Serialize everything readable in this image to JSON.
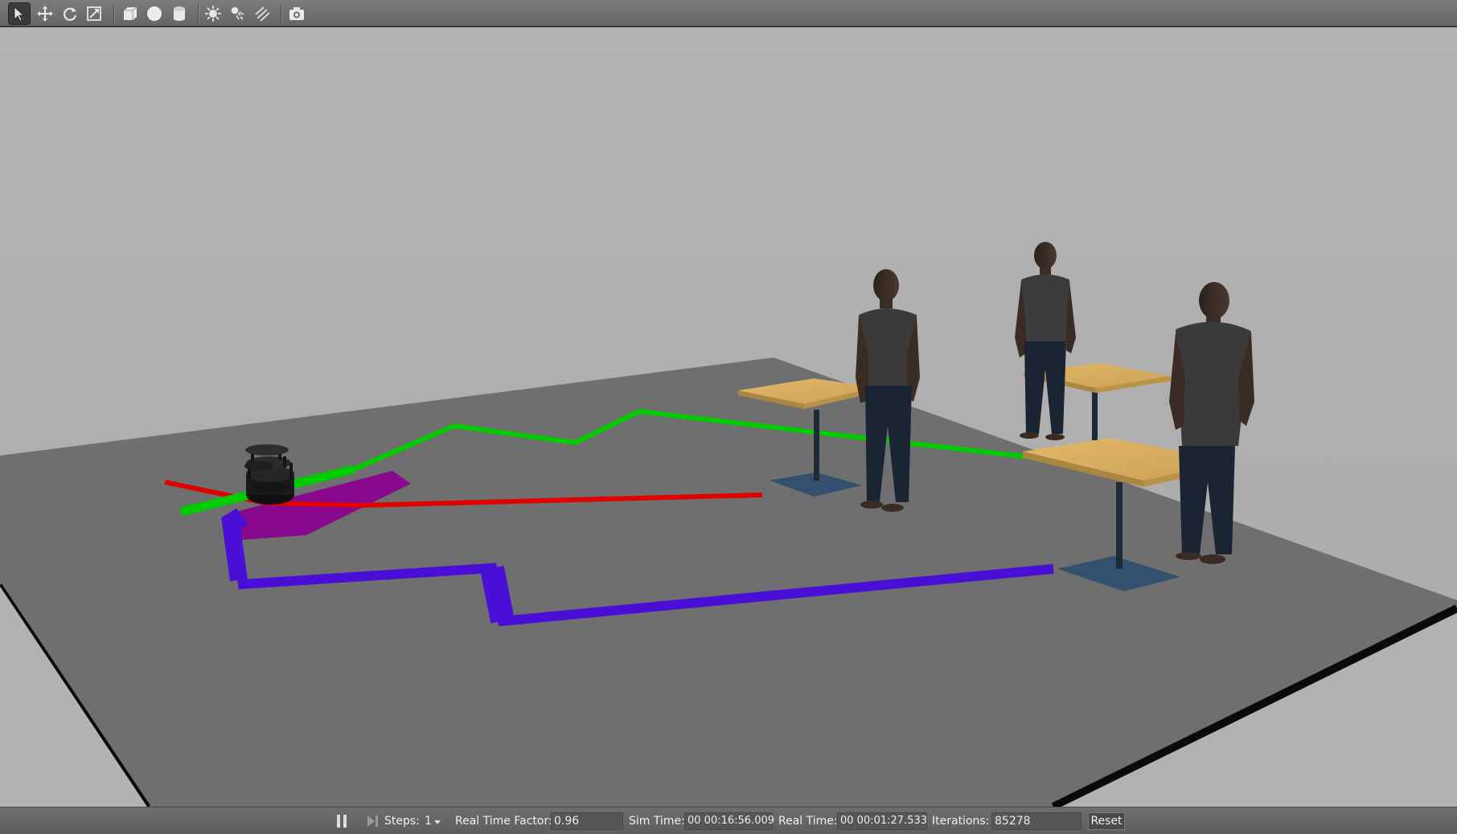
{
  "toolbar": {
    "tools": [
      {
        "name": "select-mode-icon",
        "active": true
      },
      {
        "name": "translate-mode-icon"
      },
      {
        "name": "rotate-mode-icon"
      },
      {
        "name": "scale-mode-icon"
      },
      {
        "name": "box-shape-icon"
      },
      {
        "name": "sphere-shape-icon"
      },
      {
        "name": "cylinder-shape-icon"
      },
      {
        "name": "point-light-icon"
      },
      {
        "name": "spot-light-icon"
      },
      {
        "name": "directional-light-icon"
      },
      {
        "name": "screenshot-icon"
      }
    ]
  },
  "scene": {
    "background_color": "#b0b0b0",
    "ground_color": "#6e6e6e",
    "path_colors": {
      "green": "#00cc00",
      "red": "#e00000",
      "blue": "#4a0fd6",
      "footprint": "#8a0090"
    },
    "objects": [
      "turtlebot-robot",
      "person",
      "person",
      "person",
      "cafe-table",
      "cafe-table",
      "cafe-table"
    ]
  },
  "bottom": {
    "steps_label": "Steps:",
    "steps_value": "1",
    "rtf_label": "Real Time Factor:",
    "rtf_value": "0.96",
    "sim_time_label": "Sim Time:",
    "sim_time_value": "00 00:16:56.009",
    "real_time_label": "Real Time:",
    "real_time_value": "00 00:01:27.533",
    "iterations_label": "Iterations:",
    "iterations_value": "85278",
    "reset_label": "Reset"
  }
}
